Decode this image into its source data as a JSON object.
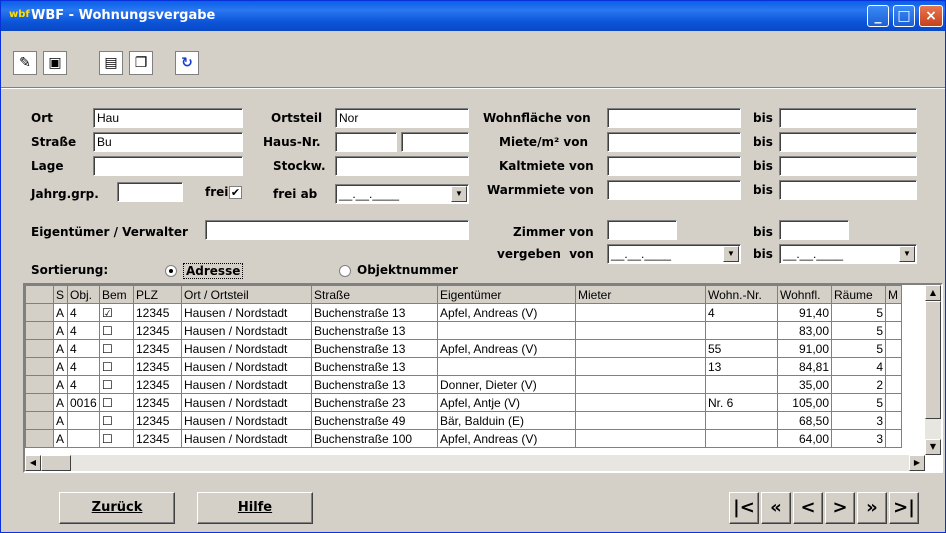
{
  "window": {
    "title": "WBF - Wohnungsvergabe",
    "app_badge": "wbf"
  },
  "form": {
    "ort_label": "Ort",
    "ort_value": "Hau",
    "strasse_label": "Straße",
    "strasse_value": "Bu",
    "lage_label": "Lage",
    "lage_value": "",
    "jahrg_label": "Jahrg.grp.",
    "jahrg_value": "",
    "frei_label": "frei",
    "frei_checked": "✔",
    "ortsteil_label": "Ortsteil",
    "ortsteil_value": "Nor",
    "hausnr_label": "Haus-Nr.",
    "stockw_label": "Stockw.",
    "freiab_label": "frei ab",
    "freiab_value": "__.__.____",
    "eigentuemer_label": "Eigentümer / Verwalter",
    "eigentuemer_value": "",
    "wohnflaeche_label": "Wohnfläche von",
    "miete_label": "Miete/m² von",
    "kaltmiete_label": "Kaltmiete von",
    "warmmiete_label": "Warmmiete von",
    "zimmer_label": "Zimmer von",
    "vergeben_label": "vergeben  von",
    "vergeben_value": "__.__.____",
    "bis_label": "bis",
    "bis_date_value": "__.__.____",
    "sortierung_label": "Sortierung:",
    "sort_adresse": "Adresse",
    "sort_objekt": "Objektnummer"
  },
  "table": {
    "headers": [
      "S",
      "Obj.",
      "Bem",
      "PLZ",
      "Ort / Ortsteil",
      "Straße",
      "Eigentümer",
      "Mieter",
      "Wohn.-Nr.",
      "Wohnfl.",
      "Räume",
      "M"
    ],
    "rows": [
      [
        "A",
        "4",
        "☑",
        "12345",
        "Hausen / Nordstadt",
        "Buchenstraße 13",
        "Apfel, Andreas (V)",
        "",
        "4",
        "91,40",
        "5"
      ],
      [
        "A",
        "4",
        "☐",
        "12345",
        "Hausen / Nordstadt",
        "Buchenstraße 13",
        "",
        "",
        "",
        "83,00",
        "5"
      ],
      [
        "A",
        "4",
        "☐",
        "12345",
        "Hausen / Nordstadt",
        "Buchenstraße 13",
        "Apfel, Andreas (V)",
        "",
        "55",
        "91,00",
        "5"
      ],
      [
        "A",
        "4",
        "☐",
        "12345",
        "Hausen / Nordstadt",
        "Buchenstraße 13",
        "",
        "",
        "13",
        "84,81",
        "4"
      ],
      [
        "A",
        "4",
        "☐",
        "12345",
        "Hausen / Nordstadt",
        "Buchenstraße 13",
        "Donner, Dieter (V)",
        "",
        "",
        "35,00",
        "2"
      ],
      [
        "A",
        "0016",
        "☐",
        "12345",
        "Hausen / Nordstadt",
        "Buchenstraße 23",
        "Apfel, Antje (V)",
        "",
        "Nr. 6",
        "105,00",
        "5"
      ],
      [
        "A",
        "",
        "☐",
        "12345",
        "Hausen / Nordstadt",
        "Buchenstraße 49",
        "Bär, Balduin (E)",
        "",
        "",
        "68,50",
        "3"
      ],
      [
        "A",
        "",
        "☐",
        "12345",
        "Hausen / Nordstadt",
        "Buchenstraße 100",
        "Apfel, Andreas (V)",
        "",
        "",
        "64,00",
        "3"
      ]
    ]
  },
  "buttons": {
    "back": "Zurück",
    "help": "Hilfe"
  },
  "nav": {
    "first": "|<",
    "prev_page": "«",
    "prev": "<",
    "next": ">",
    "next_page": "»",
    "last": ">|"
  }
}
